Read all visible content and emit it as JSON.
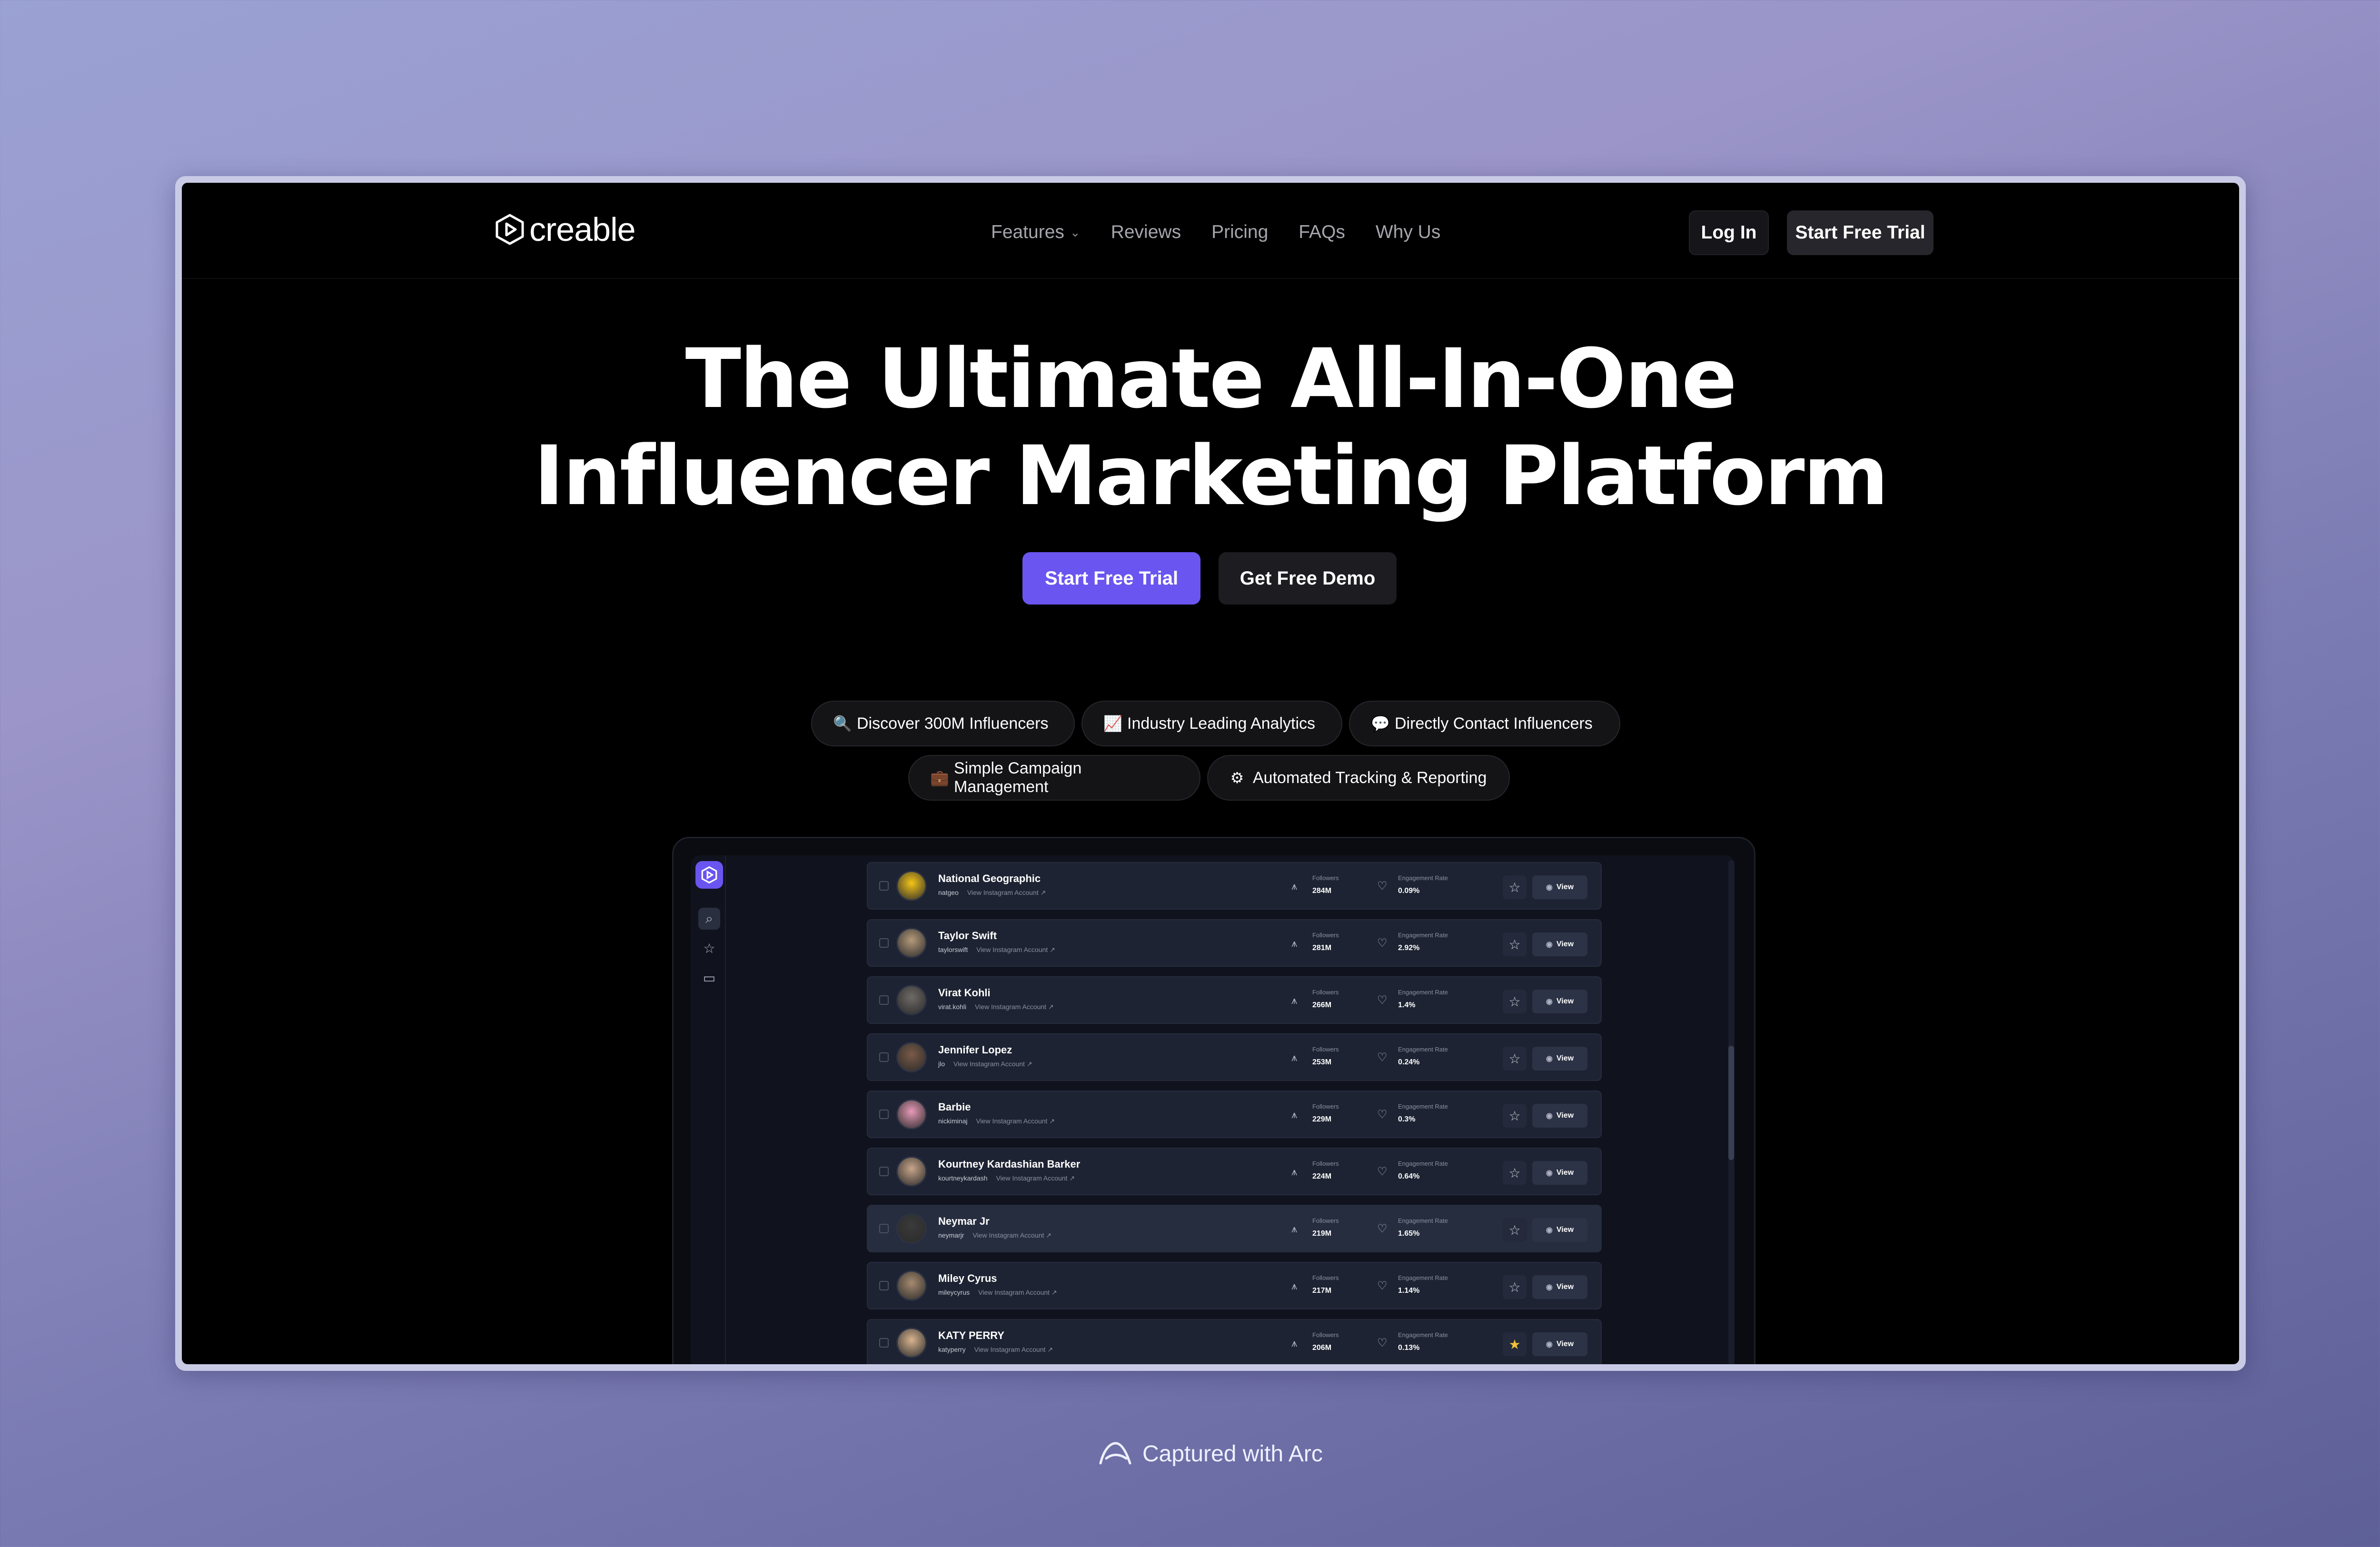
{
  "nav": {
    "brand": "creable",
    "links": [
      {
        "label": "Features"
      },
      {
        "label": "Reviews"
      },
      {
        "label": "Pricing"
      },
      {
        "label": "FAQs"
      },
      {
        "label": "Why Us"
      }
    ],
    "login": "Log In",
    "trial": "Start Free Trial"
  },
  "hero": {
    "title_line1": "The Ultimate All-In-One",
    "title_line2": "Influencer Marketing Platform",
    "cta_primary": "Start Free Trial",
    "cta_secondary": "Get Free Demo"
  },
  "features": [
    {
      "label": "Discover 300M Influencers",
      "icon": "magnifier-icon"
    },
    {
      "label": "Industry Leading Analytics",
      "icon": "chart-icon"
    },
    {
      "label": "Directly Contact Influencers",
      "icon": "speech-bubble-icon"
    },
    {
      "label": "Simple Campaign Management",
      "icon": "briefcase-icon"
    },
    {
      "label": "Automated Tracking & Reporting",
      "icon": "gear-icon"
    }
  ],
  "app": {
    "followers_label": "Followers",
    "engagement_label": "Engagement Rate",
    "view_label": "View",
    "link_label": "View Instagram Account",
    "influencers": [
      {
        "name": "National Geographic",
        "handle": "natgeo",
        "followers": "284M",
        "engagement": "0.09%",
        "favorited": false,
        "avatar": "#f5c518"
      },
      {
        "name": "Taylor Swift",
        "handle": "taylorswift",
        "followers": "281M",
        "engagement": "2.92%",
        "favorited": false,
        "avatar": "#b59a7a"
      },
      {
        "name": "Virat Kohli",
        "handle": "virat.kohli",
        "followers": "266M",
        "engagement": "1.4%",
        "favorited": false,
        "avatar": "#6e6a66"
      },
      {
        "name": "Jennifer Lopez",
        "handle": "jlo",
        "followers": "253M",
        "engagement": "0.24%",
        "favorited": false,
        "avatar": "#7a5a48"
      },
      {
        "name": "Barbie",
        "handle": "nickiminaj",
        "followers": "229M",
        "engagement": "0.3%",
        "favorited": false,
        "avatar": "#e79ab7"
      },
      {
        "name": "Kourtney Kardashian Barker",
        "handle": "kourtneykardash",
        "followers": "224M",
        "engagement": "0.64%",
        "favorited": false,
        "avatar": "#c8a58a"
      },
      {
        "name": "Neymar Jr",
        "handle": "neymarjr",
        "followers": "219M",
        "engagement": "1.65%",
        "favorited": false,
        "avatar": "#3a3a3a"
      },
      {
        "name": "Miley Cyrus",
        "handle": "mileycyrus",
        "followers": "217M",
        "engagement": "1.14%",
        "favorited": false,
        "avatar": "#a68a70"
      },
      {
        "name": "KATY PERRY",
        "handle": "katyperry",
        "followers": "206M",
        "engagement": "0.13%",
        "favorited": true,
        "avatar": "#d9b48f"
      }
    ]
  },
  "footer": {
    "captured": "Captured with Arc"
  },
  "colors": {
    "accent": "#6a55f0",
    "background": "#000000",
    "favorite": "#f2c23a"
  }
}
